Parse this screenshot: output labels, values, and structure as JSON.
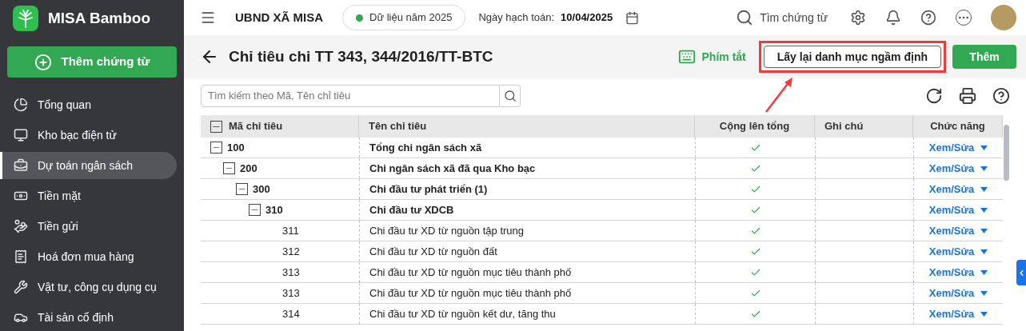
{
  "app": {
    "name": "MISA Bamboo"
  },
  "sidebar": {
    "primary_button": "Thêm chứng từ",
    "items": [
      {
        "label": "Tổng quan",
        "selected": false
      },
      {
        "label": "Kho bạc điện tử",
        "selected": false
      },
      {
        "label": "Dự toán ngân sách",
        "selected": true
      },
      {
        "label": "Tiền mặt",
        "selected": false
      },
      {
        "label": "Tiền gửi",
        "selected": false
      },
      {
        "label": "Hoá đơn mua hàng",
        "selected": false
      },
      {
        "label": "Vật tư, công cụ dụng cụ",
        "selected": false
      },
      {
        "label": "Tài sản cố định",
        "selected": false
      }
    ]
  },
  "header": {
    "organization": "UBND XÃ MISA",
    "data_year": "Dữ liệu năm 2025",
    "posting_date_label": "Ngày hạch toán:",
    "posting_date": "10/04/2025",
    "search": "Tìm chứng từ"
  },
  "page": {
    "title": "Chỉ tiêu chi TT 343, 344/2016/TT-BTC",
    "shortcuts": "Phím tắt",
    "reset_button": {
      "label": "Lấy lại danh mục ngầm định",
      "highlighted": true
    },
    "add_button": "Thêm"
  },
  "search": {
    "placeholder": "Tìm kiếm theo Mã, Tên chỉ tiêu"
  },
  "table": {
    "columns": [
      "Mã chỉ tiêu",
      "Tên chỉ tiêu",
      "Cộng lên tổng",
      "Ghi chú",
      "Chức năng"
    ],
    "rows": [
      {
        "code": "100",
        "name": "Tổng chi ngân sách xã",
        "sum_up": true,
        "action": "Xem/Sửa",
        "expanded": true,
        "children": [
          {
            "code": "200",
            "name": "Chi ngân sách xã đã qua Kho bạc",
            "sum_up": true,
            "action": "Xem/Sửa",
            "expanded": true,
            "children": [
              {
                "code": "300",
                "name": "Chi đầu tư phát triển (1)",
                "sum_up": true,
                "action": "Xem/Sửa",
                "expanded": true,
                "children": [
                  {
                    "code": "310",
                    "name": "Chi đầu tư XDCB",
                    "sum_up": true,
                    "action": "Xem/Sửa",
                    "expanded": true,
                    "children": [
                      {
                        "code": "311",
                        "name": "Chi đầu tư XD từ nguồn tập trung",
                        "sum_up": true,
                        "action": "Xem/Sửa"
                      },
                      {
                        "code": "312",
                        "name": "Chi đầu tư XD từ nguồn đất",
                        "sum_up": true,
                        "action": "Xem/Sửa"
                      },
                      {
                        "code": "313",
                        "name": "Chi đầu tư XD từ nguồn mục tiêu thành phố",
                        "sum_up": true,
                        "action": "Xem/Sửa"
                      },
                      {
                        "code": "313",
                        "name": "Chi đầu tư XD từ nguồn mục tiêu thành phố",
                        "sum_up": true,
                        "action": "Xem/Sửa"
                      },
                      {
                        "code": "314",
                        "name": "Chi đầu tư XD từ nguồn kết dư, tăng thu",
                        "sum_up": true,
                        "action": "Xem/Sửa"
                      }
                    ]
                  }
                ]
              }
            ]
          }
        ]
      }
    ]
  }
}
